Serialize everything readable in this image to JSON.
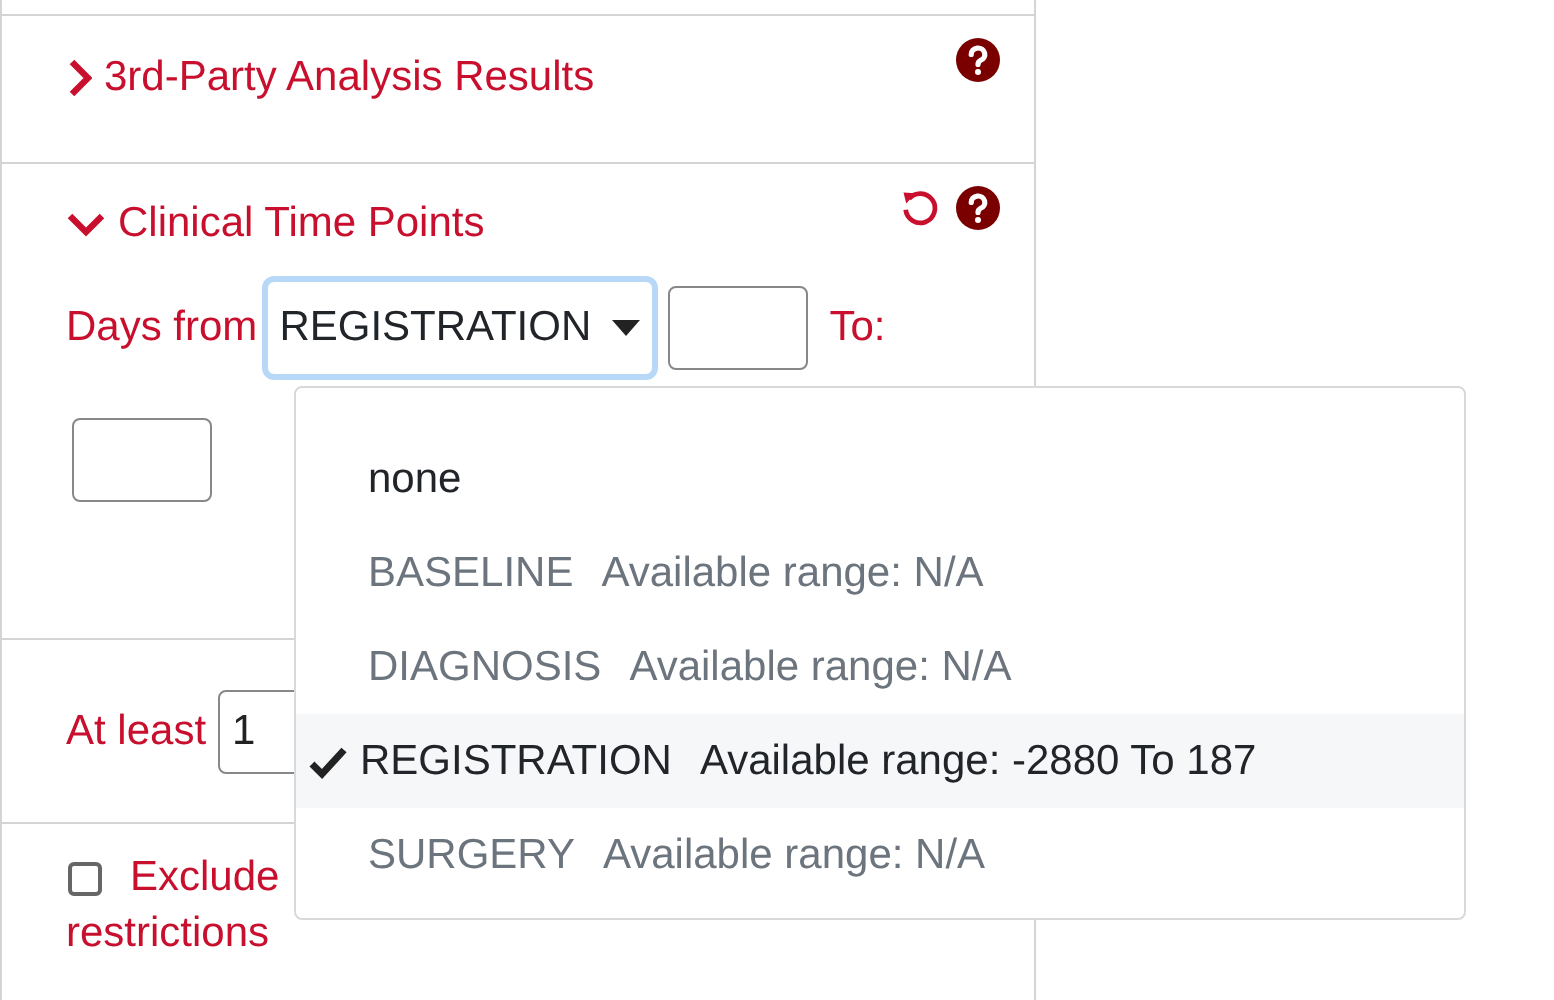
{
  "sections": [
    {
      "kind": "collapsible",
      "title": "3rd-Party Analysis Results",
      "expanded": false,
      "help": true,
      "reset": false
    },
    {
      "kind": "collapsible",
      "title": "Clinical Time Points",
      "expanded": true,
      "help": true,
      "reset": true,
      "days_from_label": "Days from",
      "select_value": "REGISTRATION",
      "to_label": "To:"
    },
    {
      "kind": "atleast",
      "label": "At least",
      "value": "1"
    },
    {
      "kind": "checkbox",
      "checked": false,
      "label": "Exclude",
      "label_continued": "restrictions"
    }
  ],
  "dropdown": {
    "options": [
      {
        "name": "none",
        "selected": false,
        "disabled": false
      },
      {
        "name": "BASELINE",
        "range": "Available range: N/A",
        "selected": false,
        "disabled": true
      },
      {
        "name": "DIAGNOSIS",
        "range": "Available range: N/A",
        "selected": false,
        "disabled": true
      },
      {
        "name": "REGISTRATION",
        "range": "Available range: -2880 To 187",
        "selected": true,
        "disabled": false
      },
      {
        "name": "SURGERY",
        "range": "Available range: N/A",
        "selected": false,
        "disabled": true
      }
    ]
  }
}
